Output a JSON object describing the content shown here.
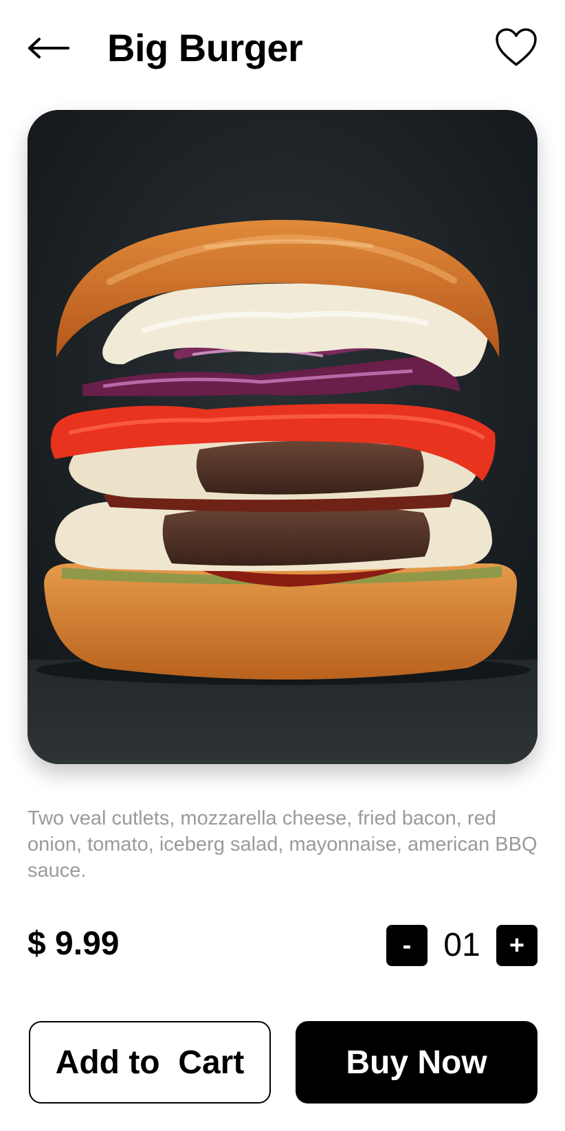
{
  "header": {
    "title": "Big Burger",
    "back_icon": "arrow-left-icon",
    "favorite_icon": "heart-outline-icon"
  },
  "product": {
    "image_alt": "Burger photo",
    "description": "Two veal cutlets, mozzarella cheese, fried bacon, red onion, tomato, iceberg salad, mayonnaise, american BBQ sauce.",
    "price": "$ 9.99"
  },
  "quantity": {
    "minus_label": "-",
    "value": "01",
    "plus_label": "+"
  },
  "actions": {
    "add_to_cart_label": "Add to  Cart",
    "buy_now_label": "Buy Now"
  },
  "colors": {
    "primary": "#000000",
    "background": "#ffffff",
    "description_text": "#9a9a9a"
  }
}
